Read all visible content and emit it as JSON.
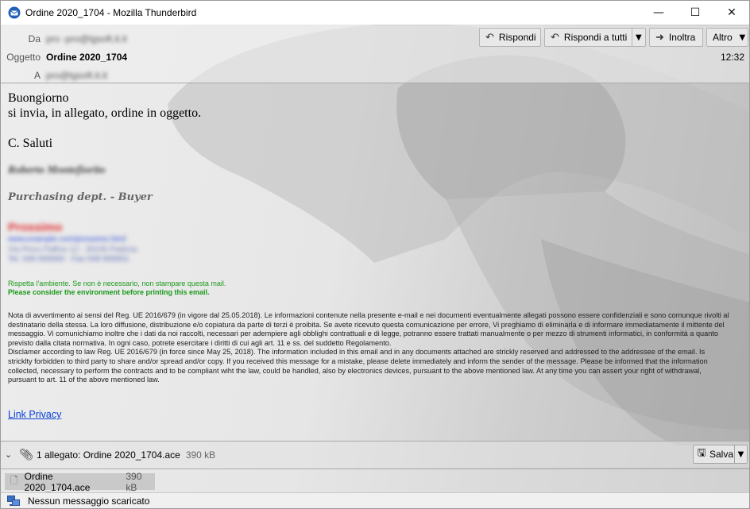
{
  "window": {
    "title": "Ordine 2020_1704 - Mozilla Thunderbird",
    "controls": {
      "minimize": "—",
      "maximize": "☐",
      "close": "✕"
    }
  },
  "header": {
    "from_label": "Da",
    "from_value": "pro -pro@lgsoft.it.it",
    "subject_label": "Oggetto",
    "subject_value": "Ordine 2020_1704",
    "to_label": "A",
    "to_value": "pro@lgsoft.it.it",
    "time": "12:32",
    "buttons": {
      "reply": "Rispondi",
      "reply_all": "Rispondi a tutti",
      "forward": "Inoltra",
      "more": "Altro"
    }
  },
  "body": {
    "greeting": "Buongiorno",
    "line1": "si invia, in allegato, ordine in oggetto.",
    "closing": "C. Saluti",
    "signature_name": "Roberto Montefiorito",
    "signature_dept": "Purchasing dept. - Buyer",
    "company_block": [
      "Prossimo",
      "www.example.com/prossimo.html",
      "Via Pinco Pallino 12 - 35100 Padova",
      "Tel. 049 000000 · Fax 049 000001"
    ],
    "env_it": "Rispetta l'ambiente. Se non è necessario, non stampare questa mail.",
    "env_en": "Please consider the environment before printing this email.",
    "disclaimer_it": "Nota di avvertimento ai sensi del Reg. UE 2016/679 (in vigore dal 25.05.2018). Le informazioni contenute nella presente e-mail e nei documenti eventualmente allegati possono essere confidenziali e sono comunque rivolti al destinatario della stessa. La loro diffusione, distribuzione e/o copiatura da parte di terzi è proibita. Se avete ricevuto questa comunicazione per errore, Vi preghiamo di eliminarla e di informare immediatamente il mittente del messaggio. Vi comunichiamo inoltre che i dati da noi raccolti, necessari per adempiere agli obblighi contrattuali e di legge, potranno essere trattati manualmente o per mezzo di strumenti informatici, in conformità a quanto previsto dalla citata normativa. In ogni caso, potrete esercitare i diritti di cui agli art. 11 e ss. del suddetto Regolamento.",
    "disclaimer_en": "Disclamer according to law Reg. UE 2016/679 (in force since May 25, 2018). The information included in this email and in any documents attached are strickly reserved and addressed to the addressee of the email. Is stricklty forbidden to third party to share and/or spread and/or copy. If you received this message for a mistake, please delete immediately and inform the sender of the message. Please be informed that the information collected, necessary to perform the contracts and to be compliant wiht the law, could be handled, also by electronics devices, pursuant to the above mentioned law. At any time you can assert your right of withdrawal, pursuant to art. 11 of the above mentioned law.",
    "link_privacy": "Link Privacy"
  },
  "attachments": {
    "summary": "1 allegato: Ordine 2020_1704.ace",
    "summary_size": "390 kB",
    "save_label": "Salva",
    "items": [
      {
        "name": "Ordine 2020_1704.ace",
        "size": "390 kB"
      }
    ]
  },
  "status": {
    "text": "Nessun messaggio scaricato"
  }
}
